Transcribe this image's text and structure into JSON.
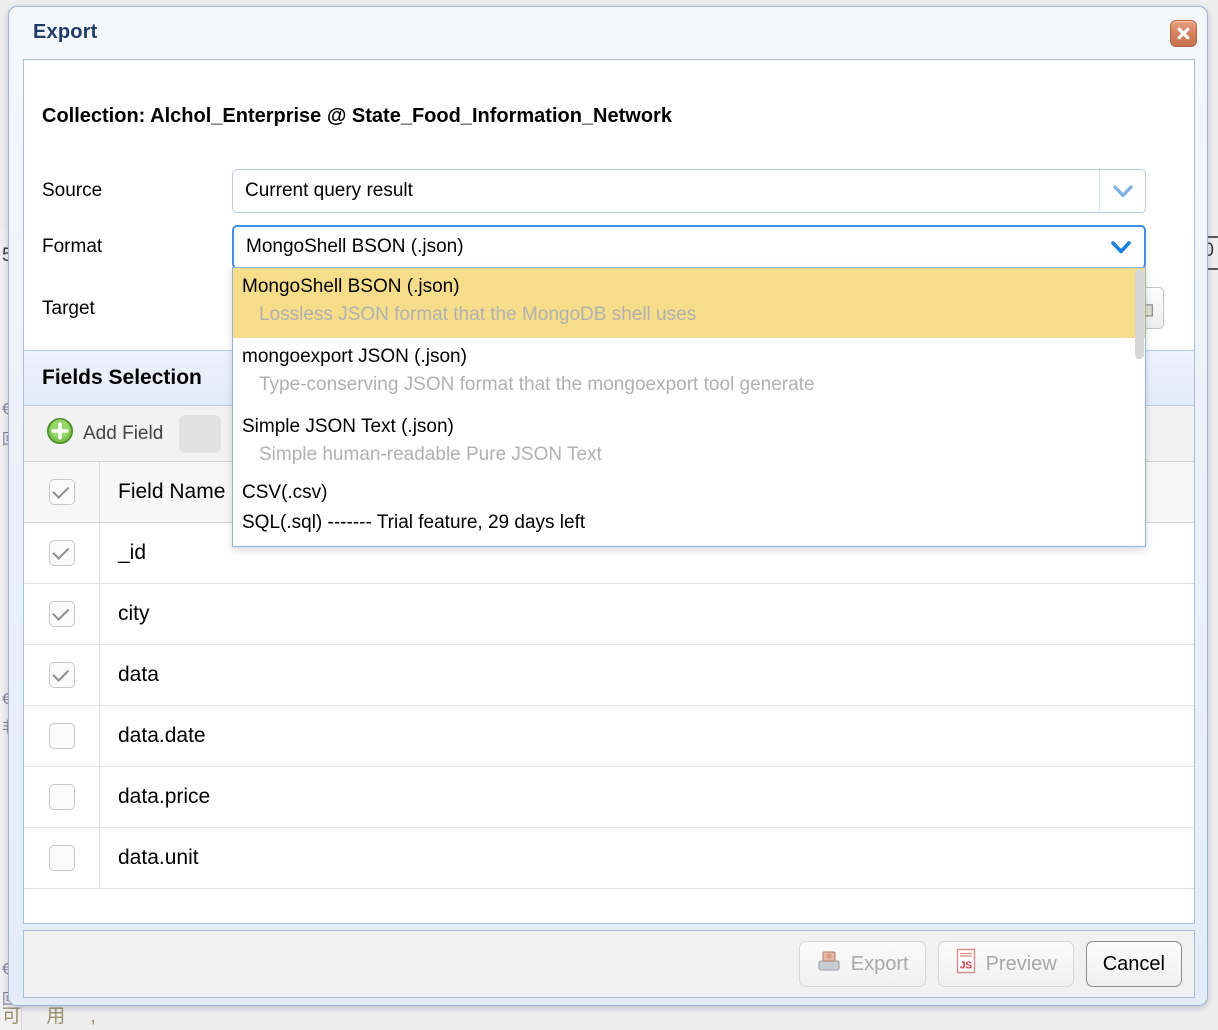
{
  "background": {
    "top_number": "5",
    "right_number": "0",
    "bottom_text": "可 用 ,",
    "glyphs": [
      "€",
      "回",
      "€",
      "非",
      "€",
      "回"
    ]
  },
  "dialog": {
    "title": "Export",
    "close_icon": "close-icon",
    "collection_line": "Collection: Alchol_Enterprise @ State_Food_Information_Network",
    "form": {
      "source": {
        "label": "Source",
        "value": "Current query result",
        "arrow_icon": "chevron-down-icon"
      },
      "format": {
        "label": "Format",
        "value": "MongoShell BSON (.json)",
        "arrow_icon": "chevron-down-icon"
      },
      "target": {
        "label": "Target",
        "browse_icon": "folder-icon"
      }
    },
    "format_dropdown": {
      "options": [
        {
          "title": "MongoShell BSON (.json)",
          "description": "Lossless JSON format that the MongoDB shell uses",
          "selected": true
        },
        {
          "title": "mongoexport JSON (.json)",
          "description": "Type-conserving JSON format that the mongoexport tool generate",
          "selected": false
        },
        {
          "title": "Simple JSON Text (.json)",
          "description": "Simple human-readable Pure JSON Text",
          "selected": false
        },
        {
          "title": "CSV(.csv)",
          "description": "",
          "selected": false
        },
        {
          "title": "SQL(.sql) ------- Trial feature, 29 days left",
          "description": "",
          "selected": false
        }
      ]
    },
    "fields_section": {
      "header_title": "Fields Selection",
      "add_field_label": "Add Field",
      "add_field_icon": "plus-circle-icon",
      "columns": [
        "Field Name"
      ],
      "rows": [
        {
          "name": "_id",
          "checked": true
        },
        {
          "name": "city",
          "checked": true
        },
        {
          "name": "data",
          "checked": true
        },
        {
          "name": "data.date",
          "checked": false
        },
        {
          "name": "data.price",
          "checked": false
        },
        {
          "name": "data.unit",
          "checked": false
        }
      ]
    },
    "footer": {
      "buttons": [
        {
          "label": "Export",
          "icon": "printer-icon",
          "disabled": true
        },
        {
          "label": "Preview",
          "icon": "js-file-icon",
          "disabled": true
        },
        {
          "label": "Cancel",
          "icon": "",
          "disabled": false
        }
      ]
    }
  },
  "colors": {
    "dialog_border": "#9db4d6",
    "title_text": "#1f3b66",
    "close_button": "#d4805c",
    "dropdown_highlight": "#f5dd8a",
    "dropdown_desc_text": "#b1b1b1",
    "combo_focus_border": "#3f91e6",
    "panel_header": "#e8eefa",
    "add_icon_green": "#5cb85c"
  }
}
